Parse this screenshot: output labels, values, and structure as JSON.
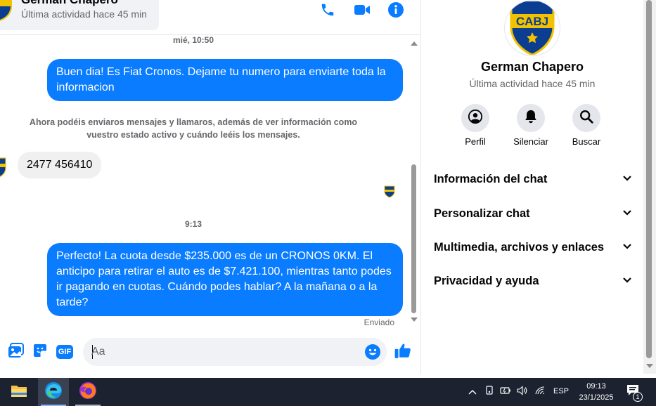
{
  "contact": {
    "name": "German Chapero",
    "status": "Última actividad hace 45 min",
    "avatar_text": "CABJ"
  },
  "colors": {
    "accent": "#0a7cff",
    "boca_blue": "#0b3d91",
    "boca_gold": "#f2c200"
  },
  "header": {
    "icons": [
      "phone-icon",
      "video-icon",
      "info-icon"
    ]
  },
  "messages": {
    "timestamp_1": "mié, 10:50",
    "out_1": "Buen dia!  Es Fiat Cronos. Dejame tu numero para enviarte toda la informacion",
    "system_note": "Ahora podéis enviaros mensajes y llamaros, además de ver información como vuestro estado activo y cuándo leéis los mensajes.",
    "in_1": "2477 456410",
    "timestamp_2": "9:13",
    "out_2": "Perfecto! La cuota desde $235.000 es de un CRONOS 0KM. El anticipo para retirar el auto es de $7.421.100, mientras tanto podes ir pagando en cuotas. Cuándo podes hablar? A la mañana o a la tarde?",
    "sent_status": "Enviado"
  },
  "composer": {
    "placeholder": "Aa",
    "icons": [
      "photo-icon",
      "sticker-icon",
      "gif-icon",
      "emoji-icon",
      "like-icon"
    ],
    "gif_label": "GIF"
  },
  "panel": {
    "actions": [
      {
        "label": "Perfil",
        "icon": "profile-icon"
      },
      {
        "label": "Silenciar",
        "icon": "bell-icon"
      },
      {
        "label": "Buscar",
        "icon": "search-icon"
      }
    ],
    "sections": [
      {
        "title": "Información del chat"
      },
      {
        "title": "Personalizar chat"
      },
      {
        "title": "Multimedia, archivos y enlaces"
      },
      {
        "title": "Privacidad y ayuda"
      }
    ]
  },
  "taskbar": {
    "apps": [
      "file-explorer-icon",
      "edge-icon",
      "firefox-icon"
    ],
    "language": "ESP",
    "time": "09:13",
    "date": "23/1/2025",
    "notification_count": "1"
  }
}
